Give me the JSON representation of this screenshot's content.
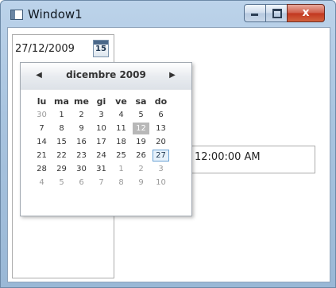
{
  "window": {
    "title": "Window1",
    "close_glyph": "x"
  },
  "date_picker": {
    "text": "27/12/2009",
    "button_day": "15"
  },
  "time_field": {
    "text": "12:00:00 AM"
  },
  "calendar": {
    "month_title": "dicembre 2009",
    "prev_glyph": "◀",
    "next_glyph": "▶",
    "weekdays": [
      "lu",
      "ma",
      "me",
      "gi",
      "ve",
      "sa",
      "do"
    ],
    "weeks": [
      [
        {
          "d": "30",
          "o": true
        },
        {
          "d": "1"
        },
        {
          "d": "2"
        },
        {
          "d": "3"
        },
        {
          "d": "4"
        },
        {
          "d": "5"
        },
        {
          "d": "6"
        }
      ],
      [
        {
          "d": "7"
        },
        {
          "d": "8"
        },
        {
          "d": "9"
        },
        {
          "d": "10"
        },
        {
          "d": "11"
        },
        {
          "d": "12",
          "sel": true
        },
        {
          "d": "13"
        }
      ],
      [
        {
          "d": "14"
        },
        {
          "d": "15"
        },
        {
          "d": "16"
        },
        {
          "d": "17"
        },
        {
          "d": "18"
        },
        {
          "d": "19"
        },
        {
          "d": "20"
        }
      ],
      [
        {
          "d": "21"
        },
        {
          "d": "22"
        },
        {
          "d": "23"
        },
        {
          "d": "24"
        },
        {
          "d": "25"
        },
        {
          "d": "26"
        },
        {
          "d": "27",
          "today": true
        }
      ],
      [
        {
          "d": "28"
        },
        {
          "d": "29"
        },
        {
          "d": "30"
        },
        {
          "d": "31"
        },
        {
          "d": "1",
          "o": true
        },
        {
          "d": "2",
          "o": true
        },
        {
          "d": "3",
          "o": true
        }
      ],
      [
        {
          "d": "4",
          "o": true
        },
        {
          "d": "5",
          "o": true
        },
        {
          "d": "6",
          "o": true
        },
        {
          "d": "7",
          "o": true
        },
        {
          "d": "8",
          "o": true
        },
        {
          "d": "9",
          "o": true
        },
        {
          "d": "10",
          "o": true
        }
      ]
    ]
  },
  "colors": {
    "titlebar": "#a9c4df",
    "close_button": "#c2371f",
    "selected_day": "#b8b8b8",
    "today_border": "#6aa1d4"
  }
}
